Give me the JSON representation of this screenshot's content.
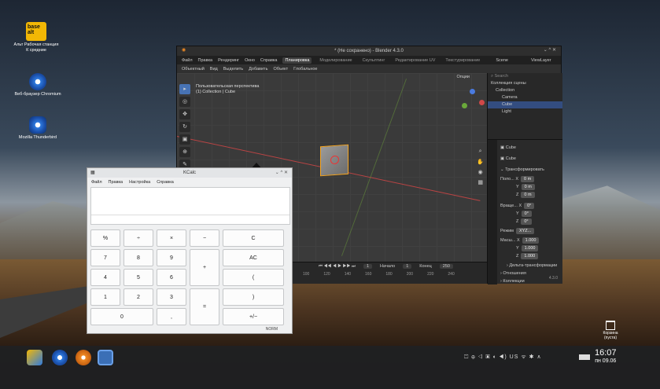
{
  "desktop": {
    "icons": [
      {
        "label": "Альт Рабочая станция К средние",
        "kind": "logo",
        "logo_text": "base alt"
      },
      {
        "label": "Веб-браузер Chromium",
        "kind": "chromium"
      },
      {
        "label": "Mozilla Thunderbird",
        "kind": "thunderbird"
      }
    ],
    "trash": {
      "label": "Корзина (пуста)"
    }
  },
  "blender": {
    "title": "* (Не сохранено) - Blender 4.3.0",
    "window_controls": "⌄ ^ ✕",
    "menu": [
      "Файл",
      "Правка",
      "Рендеринг",
      "Окно",
      "Справка"
    ],
    "workspaces": [
      "Планировка",
      "Моделирование",
      "Скульптинг",
      "Редактирование UV",
      "Текстурирование"
    ],
    "scene_label": "Scene",
    "viewlayer_label": "ViewLayer",
    "toolbar": [
      "Объектный",
      "Вид",
      "Выделить",
      "Добавить",
      "Объект",
      "Глобальное"
    ],
    "overlay_label": "Опции",
    "viewport_line1": "Пользовательская перспектива",
    "viewport_line2": "(1) Collection | Cube",
    "timeline": {
      "frame": "1",
      "start_label": "Начало",
      "start": "1",
      "end_label": "Конец",
      "end": "250",
      "ticks": [
        "100",
        "120",
        "140",
        "160",
        "180",
        "200",
        "220",
        "240"
      ]
    },
    "outliner": {
      "search_placeholder": "Search",
      "rows": [
        "Коллекция сцены",
        "Collection",
        "Camera",
        "Cube",
        "Light"
      ]
    },
    "properties": {
      "object_name": "Cube",
      "data_name": "Cube",
      "section": "Трансформировать",
      "location_label": "Поло...",
      "rotation_label": "Враще...",
      "scale_label": "Масш...",
      "mode_label": "Режим",
      "mode_value": "XYZ...",
      "loc": [
        "0 m",
        "0 m",
        "0 m"
      ],
      "rot": [
        "0°",
        "0°",
        "0°"
      ],
      "scale": [
        "1.000",
        "1.000",
        "1.000"
      ],
      "axes": [
        "X",
        "Y",
        "Z"
      ],
      "delta": "Дельта-трансформации",
      "relations": "Отношения",
      "collections": "Коллекции",
      "version": "4.3.0"
    }
  },
  "kcalc": {
    "title": "KCalc",
    "window_controls": "⌄ ^ ✕",
    "menu": [
      "Файл",
      "Правка",
      "Настройка",
      "Справка"
    ],
    "buttons": [
      "%",
      "÷",
      "×",
      "−",
      "C",
      "7",
      "8",
      "9",
      "+",
      "AC",
      "4",
      "5",
      "6",
      "(",
      "1",
      "2",
      "3",
      "=",
      ")",
      "0",
      ",",
      "+/−"
    ],
    "status": "NORM"
  },
  "taskbar": {
    "tray": "⏍ ⊕ ◁ ▣ ◐ ◀) US ᯤ ✱ ∧",
    "time": "16:07",
    "date": "пн 09.06"
  }
}
